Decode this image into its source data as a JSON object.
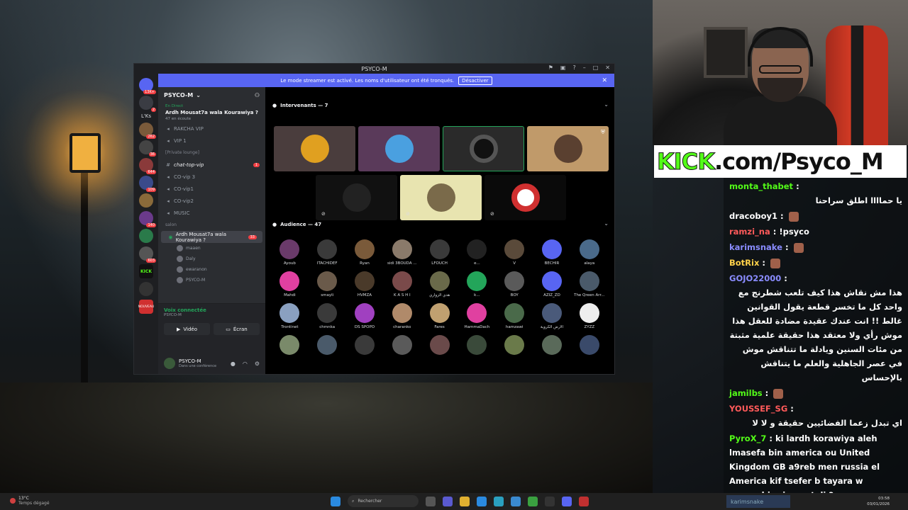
{
  "window": {
    "title": "PSYCO-M"
  },
  "banner": {
    "text": "Le mode streamer est activé. Les noms d'utilisateur ont été tronqués.",
    "button": "Désactiver"
  },
  "servers": {
    "label_lks": "L'Ks",
    "badges": [
      "13K+",
      "2",
      "262",
      "36",
      "644",
      "109",
      "140",
      "603"
    ],
    "kick_label": "KICK",
    "nouveau": "NOUVEAU"
  },
  "guild": {
    "name": "PSYCO-M",
    "live_tag": "En Direct",
    "live_title": "Ardh Mousat7a wala Kourawiya ?",
    "live_sub": "47 en écoute",
    "channels": [
      "RAKCHA VIP",
      "VIP 1",
      "[Private lounge]",
      "chat-top-vip",
      "CO-vip 3",
      "CO-vip1",
      "CO-vip2",
      "MUSIC",
      "salon"
    ],
    "active_channel_sub": "Ardh Mousat7a wala Kourawiya ?",
    "active_badge": "33",
    "vip_badge": "1",
    "members": [
      "maaen",
      "Daly",
      "ewaranon",
      "PSYCO-M"
    ]
  },
  "voice": {
    "connected": "Voix connectée",
    "sub": "PSYCO-M",
    "video": "Vidéo",
    "screen": "Écran"
  },
  "user": {
    "name": "PSYCO-M",
    "status": "Dans une conférence"
  },
  "stage": {
    "speakers_title": "Intervenants — 7",
    "audience_title": "Audience — 47",
    "audience": [
      "Ayoub",
      "ITACHIDEF",
      "Ryan",
      "sidi 3BOUDA ...",
      "LFOUCH",
      "e...",
      "V",
      "BECHIR",
      "alaya",
      "Mahdi",
      "smayli",
      "HVMZA",
      "K A S H I",
      "هدي الزواري",
      "k...",
      "BOY",
      "AZIZ_ZD",
      "The Qreen Arr...",
      "Trontinet",
      "chmnka",
      "DS SPOPO",
      "charanko",
      "Fares",
      "HammaDach",
      "hamzawi",
      "الأرض الكروية",
      "ZYZZ",
      "",
      "",
      "",
      "",
      "",
      "",
      "",
      "",
      ""
    ]
  },
  "kick": {
    "brand": "KICK",
    "rest": ".com/Psyco_M"
  },
  "chat": [
    {
      "user": "monta_thabet",
      "color": "#53fc18",
      "text": "يا حماااا اطلق سراحنا"
    },
    {
      "user": "dracoboy1",
      "color": "#ffffff",
      "text": ""
    },
    {
      "user": "ramzi_na",
      "color": "#ff5a5a",
      "text": "!psyco"
    },
    {
      "user": "karimsnake",
      "color": "#8a8cff",
      "text": ""
    },
    {
      "user": "BotRix",
      "color": "#ffd24a",
      "text": ""
    },
    {
      "user": "GOJO22000",
      "color": "#8a8cff",
      "text": "هذا مش نقاش هذا كيف تلعب شطرنج مع واحد كل ما تخسر قطعة يقول القوانين غالط !! انت عندك عقيدة مضادة للعقل هذا موش رأي ولا معتقد هذا حقيقة علمية مثبتة من مئات السنين ويادلة ما تتناقش موش في عصر الجاهلية والعلم ما يتناقش بالإحساس"
    },
    {
      "user": "jamilbs",
      "color": "#53fc18",
      "text": ""
    },
    {
      "user": "YOUSSEF_SG",
      "color": "#ff5a5a",
      "text": "اي تبدل زعما الفضائيين حقيقة و لا لا"
    },
    {
      "user": "PyroX_7",
      "color": "#53fc18",
      "text": "ki lardh korawiya aleh lmasefa bin america ou United Kingdom GB a9reb men russia el America kif tsefer b tayara w maymchiwcj men teli ?"
    }
  ],
  "taskbar": {
    "temp": "13°C",
    "weather": "Temps dégagé",
    "search": "Rechercher",
    "time": "03:58",
    "date": "03/01/2026",
    "chat_user": "karimsnake"
  }
}
